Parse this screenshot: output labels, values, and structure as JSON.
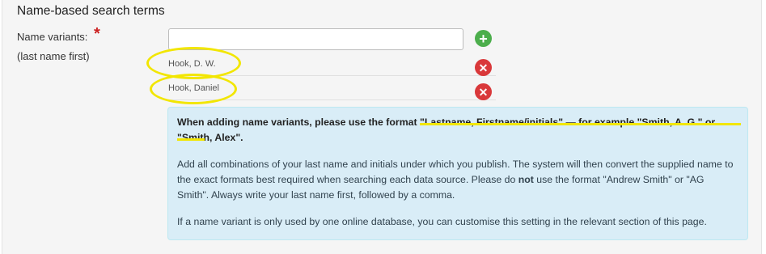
{
  "section": {
    "heading": "Name-based search terms"
  },
  "field": {
    "label": "Name variants:",
    "required_marker": "*",
    "hint": "(last name first)",
    "input_value": "",
    "input_placeholder": ""
  },
  "variants": [
    {
      "name": "Hook, D. W."
    },
    {
      "name": "Hook, Daniel"
    }
  ],
  "icons": {
    "add": "plus-icon",
    "remove": "times-icon"
  },
  "info": {
    "p1_prefix": "When adding name variants, please use the format ",
    "p1_format": "\"Lastname, Firstname/initials\" — for example \"Smith, A. G.\" or \"Smith, Alex\"",
    "p1_suffix": ".",
    "p2_a": "Add all combinations of your last name and initials under which you publish. The system will then convert the supplied name to the exact formats best required when searching each data source. Please do ",
    "p2_not": "not",
    "p2_b": " use the format \"Andrew Smith\" or \"AG Smith\". Always write your last name first, followed by a comma.",
    "p3": "If a name variant is only used by one online database, you can customise this setting in the relevant section of this page."
  },
  "colors": {
    "add_button": "#4cae4c",
    "remove_button": "#d9383a",
    "highlight": "#f2e600",
    "info_background": "#d9edf7",
    "required": "#cc2222"
  }
}
